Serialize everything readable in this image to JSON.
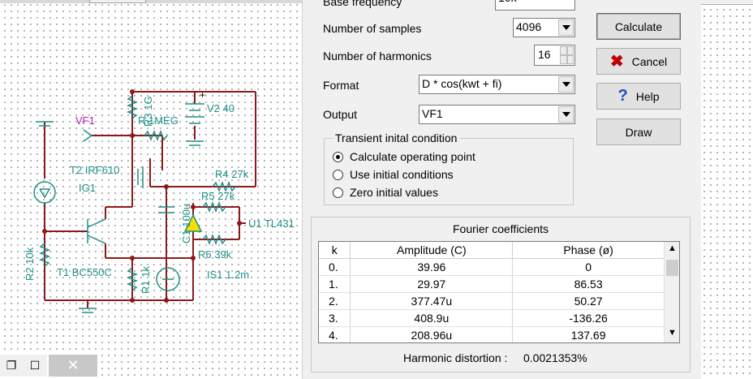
{
  "schematic": {
    "labels": {
      "vf1": "VF1",
      "r3": "R3 1G",
      "r_1meg": "R 1MEG",
      "v2": "V2 40",
      "t2": "T2 IRF610",
      "ig1": "IG1",
      "r4": "R4 27k",
      "r5": "R5 27k",
      "c1": "C1 100u",
      "u1": "U1 TL431",
      "r6": "R6 39k",
      "r2": "R2 10k",
      "t1": "T1 BC550C",
      "r1": "R1 1k",
      "is1": "IS1 1.2m"
    }
  },
  "window_controls": {
    "restore_glyph": "❐",
    "maximize_glyph": "☐",
    "close_glyph": "✕"
  },
  "dialog": {
    "base_frequency": {
      "label": "Base frequency",
      "value": "10k"
    },
    "number_of_samples": {
      "label": "Number of samples",
      "value": "4096"
    },
    "number_of_harmonics": {
      "label": "Number of harmonics",
      "value": "16"
    },
    "format": {
      "label": "Format",
      "value": "D * cos(kwt + fi)"
    },
    "output": {
      "label": "Output",
      "value": "VF1"
    },
    "transient": {
      "legend": "Transient inital condition",
      "options": [
        {
          "label": "Calculate operating point",
          "selected": true
        },
        {
          "label": "Use initial conditions",
          "selected": false
        },
        {
          "label": "Zero initial values",
          "selected": false
        }
      ]
    },
    "buttons": {
      "calculate": "Calculate",
      "cancel": "Cancel",
      "help": "Help",
      "draw": "Draw",
      "cancel_icon": "x-icon",
      "help_icon": "question-icon"
    },
    "fourier": {
      "title": "Fourier coefficients",
      "columns": [
        "k",
        "Amplitude (C)",
        "Phase (ø)"
      ],
      "rows": [
        [
          "0.",
          "39.96",
          "0"
        ],
        [
          "1.",
          "29.97",
          "86.53"
        ],
        [
          "2.",
          "377.47u",
          "50.27"
        ],
        [
          "3.",
          "408.9u",
          "-136.26"
        ],
        [
          "4.",
          "208.96u",
          "137.69"
        ]
      ],
      "harmonic_distortion_label": "Harmonic distortion :",
      "harmonic_distortion_value": "0.0021353%"
    }
  }
}
